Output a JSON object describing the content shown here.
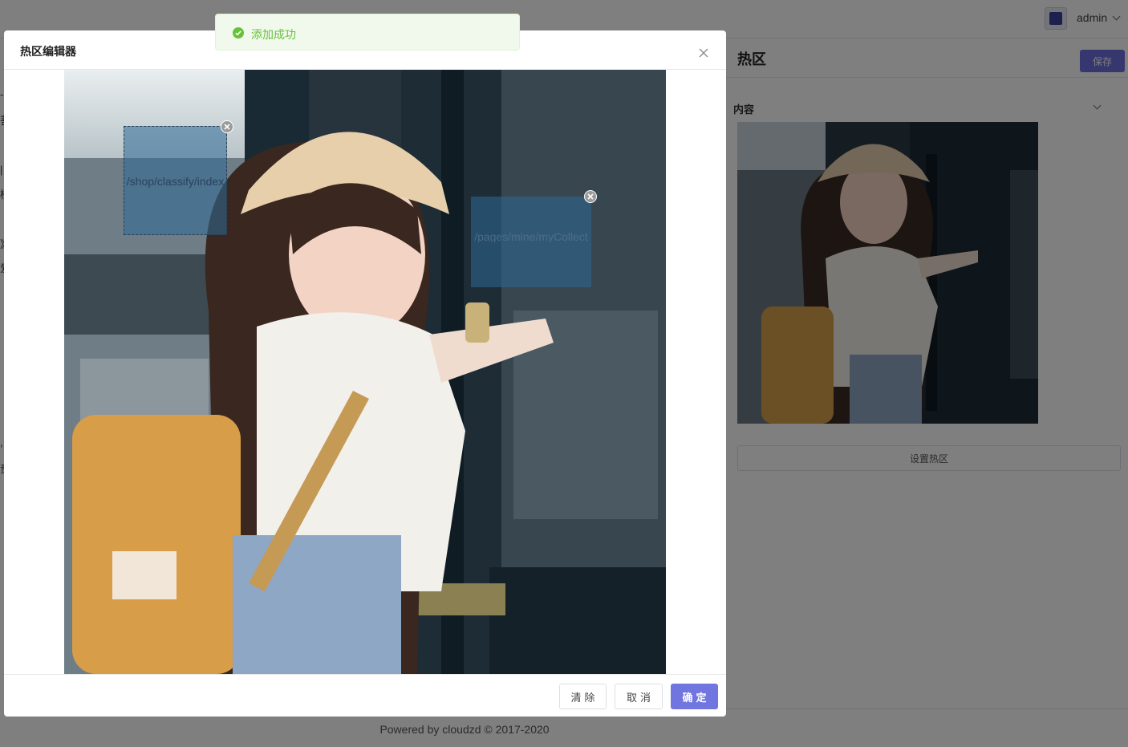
{
  "header": {
    "user": "admin"
  },
  "page": {
    "title": "热区",
    "save_label": "保存",
    "section_label": "内容",
    "set_hotzone_label": "设置热区"
  },
  "footer": {
    "text": "Powered by cloudzd © 2017-2020"
  },
  "left_fragments": [
    "-",
    "菩",
    "",
    "|",
    "楼",
    "",
    "》",
    "爱",
    "",
    ",",
    "责"
  ],
  "dialog": {
    "title": "热区编辑器",
    "hotzones": [
      {
        "label": "/shop/classify/index"
      },
      {
        "label": "/pages/mine/myCollect"
      }
    ],
    "buttons": {
      "clear": "清除",
      "cancel": "取消",
      "confirm": "确定"
    }
  },
  "toast": {
    "message": "添加成功",
    "type": "success",
    "color": "#67c23a"
  },
  "colors": {
    "primary": "#6c6fde",
    "success": "#67c23a"
  }
}
